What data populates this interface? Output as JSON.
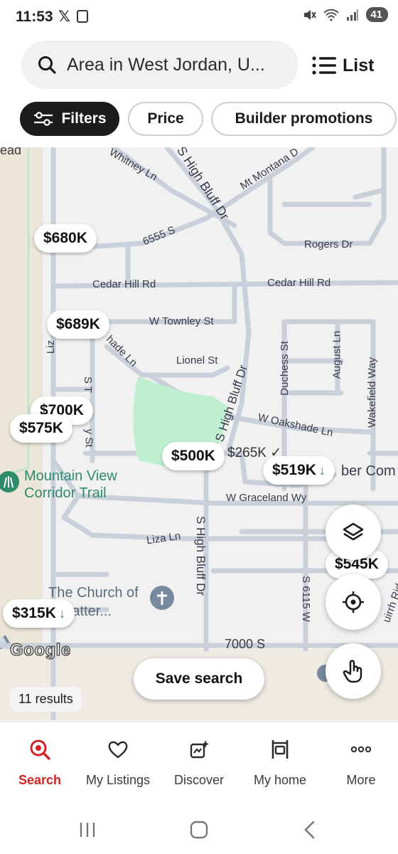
{
  "status_bar": {
    "time": "11:53",
    "x_label": "𝕏",
    "battery": "41"
  },
  "search": {
    "query": "Area in West Jordan, U...",
    "list_label": "List"
  },
  "chips": {
    "filters": "Filters",
    "price": "Price",
    "builder": "Builder promotions"
  },
  "map": {
    "roads": {
      "whitney": "Whitney Ln",
      "high_bluff_top": "S High Bluff Dr",
      "mt_montana": "Mt Montana D",
      "s6555": "6555 S",
      "rogers": "Rogers Dr",
      "cedar_hill_left": "Cedar Hill Rd",
      "cedar_hill_right": "Cedar Hill Rd",
      "townley": "W Townley St",
      "lionel": "Lionel St",
      "oakshade_left": "hade Ln",
      "oakshade_right": "W Oakshade Ln",
      "duchess": "Duchess St",
      "august": "August Ln",
      "wakefield": "Wakefield Way",
      "high_bluff_mid": "S High Bluff Dr",
      "graceland": "W Graceland Wy",
      "liza": "Liza Ln",
      "high_bluff_bottom": "S High Bluff Dr",
      "s6115": "S 6115 W",
      "s7000": "7000 S",
      "st_left": "S T",
      "st_left2": "y St",
      "liz": "Liz",
      "ead": "ead",
      "ber_com": "ber Com",
      "hirth": "uirrh Ridg"
    },
    "pins": {
      "p680": "$680K",
      "p689": "$689K",
      "p700": "$700K",
      "p575": "$575K",
      "p500": "$500K",
      "p265": "$265K ✓",
      "p519": "$519K",
      "p545": "$545K",
      "p315": "$315K"
    },
    "down_arrow": "↓",
    "trail_line1": "Mountain View",
    "trail_line2": "Corridor Trail",
    "church_line1": "The Church of",
    "church_line2": "of Latter...",
    "google": "Google",
    "results": "11 results",
    "save_search": "Save search"
  },
  "nav": {
    "search": "Search",
    "my_listings": "My Listings",
    "discover": "Discover",
    "my_home": "My home",
    "more": "More"
  },
  "colors": {
    "accent": "#d32323",
    "park": "#bfefd0",
    "trail": "#2f8a6a",
    "road": "#c9d0dc",
    "price_drop": "#2b8a3e"
  }
}
